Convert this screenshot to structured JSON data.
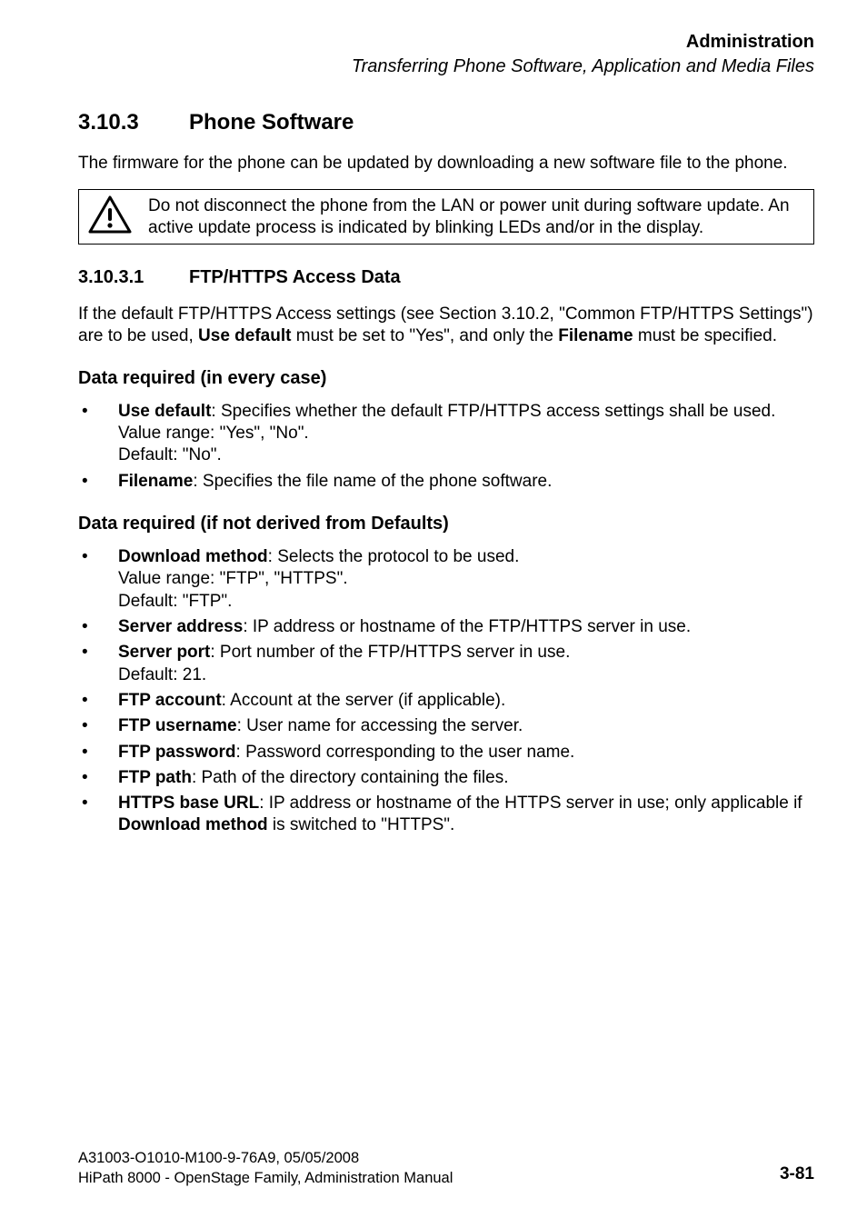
{
  "header": {
    "category": "Administration",
    "chapter_path": "Transferring Phone Software, Application and Media Files"
  },
  "section": {
    "number": "3.10.3",
    "title": "Phone Software",
    "intro": "The firmware for the phone can be updated by downloading a new software file to the phone."
  },
  "warning": {
    "text": "Do not disconnect the phone from the LAN or power unit during software update. An active update process is indicated by blinking LEDs and/or in the display."
  },
  "subsection": {
    "number": "3.10.3.1",
    "title": "FTP/HTTPS Access Data",
    "para_pre": "If the default FTP/HTTPS Access settings (see Section 3.10.2, \"Common FTP/HTTPS Settings\") are to be used, ",
    "para_bold1": "Use default",
    "para_mid": " must be set to \"Yes\", and only the ",
    "para_bold2": "Filename",
    "para_post": " must be specified."
  },
  "block1": {
    "heading": "Data required (in every case)",
    "items": [
      {
        "term": "Use default",
        "desc": ": Specifies whether the default FTP/HTTPS access settings shall be used. Value range: \"Yes\", \"No\".",
        "extra": "Default: \"No\"."
      },
      {
        "term": "Filename",
        "desc": ": Specifies the file name of the phone software.",
        "extra": ""
      }
    ]
  },
  "block2": {
    "heading": "Data required (if not derived from Defaults)",
    "items": [
      {
        "term": "Download method",
        "desc": ": Selects the protocol to be used.",
        "extra1": "Value range: \"FTP\", \"HTTPS\".",
        "extra2": "Default: \"FTP\"."
      },
      {
        "term": "Server address",
        "desc": ": IP address or hostname of the FTP/HTTPS server in use.",
        "extra1": "",
        "extra2": ""
      },
      {
        "term": "Server port",
        "desc": ": Port number of the FTP/HTTPS server in use.",
        "extra1": "Default: 21.",
        "extra2": ""
      },
      {
        "term": "FTP account",
        "desc": ": Account at the server (if applicable).",
        "extra1": "",
        "extra2": ""
      },
      {
        "term": "FTP username",
        "desc": ": User name for accessing the server.",
        "extra1": "",
        "extra2": ""
      },
      {
        "term": "FTP password",
        "desc": ": Password corresponding to the user name.",
        "extra1": "",
        "extra2": ""
      },
      {
        "term": "FTP path",
        "desc": ": Path of the directory containing the files.",
        "extra1": "",
        "extra2": ""
      }
    ],
    "last_item": {
      "term1": "HTTPS base URL",
      "mid1": ": IP address or hostname of the HTTPS server in use; only applicable if ",
      "term2": "Download method",
      "mid2": " is switched to \"HTTPS\"."
    }
  },
  "footer": {
    "line1": "A31003-O1010-M100-9-76A9, 05/05/2008",
    "line2": "HiPath 8000 - OpenStage Family, Administration Manual",
    "page": "3-81"
  }
}
